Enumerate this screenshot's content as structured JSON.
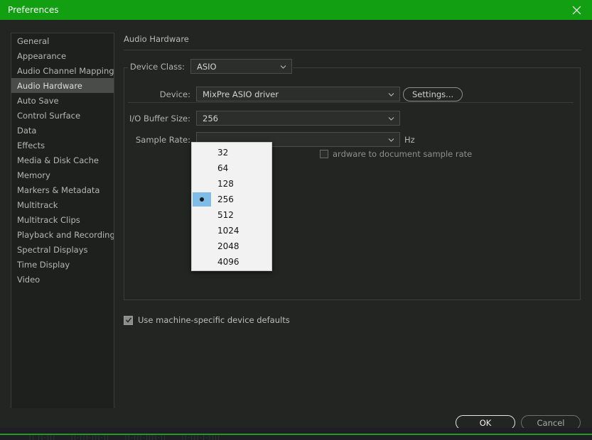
{
  "window": {
    "title": "Preferences",
    "close_icon": "close-x-icon",
    "titlebar_color": "#12a012"
  },
  "sidebar": {
    "items": [
      {
        "label": "General",
        "selected": false
      },
      {
        "label": "Appearance",
        "selected": false
      },
      {
        "label": "Audio Channel Mapping",
        "selected": false
      },
      {
        "label": "Audio Hardware",
        "selected": true
      },
      {
        "label": "Auto Save",
        "selected": false
      },
      {
        "label": "Control Surface",
        "selected": false
      },
      {
        "label": "Data",
        "selected": false
      },
      {
        "label": "Effects",
        "selected": false
      },
      {
        "label": "Media & Disk Cache",
        "selected": false
      },
      {
        "label": "Memory",
        "selected": false
      },
      {
        "label": "Markers & Metadata",
        "selected": false
      },
      {
        "label": "Multitrack",
        "selected": false
      },
      {
        "label": "Multitrack Clips",
        "selected": false
      },
      {
        "label": "Playback and Recording",
        "selected": false
      },
      {
        "label": "Spectral Displays",
        "selected": false
      },
      {
        "label": "Time Display",
        "selected": false
      },
      {
        "label": "Video",
        "selected": false
      }
    ]
  },
  "main": {
    "pane_title": "Audio Hardware",
    "device_class": {
      "label": "Device Class:",
      "value": "ASIO"
    },
    "device": {
      "label": "Device:",
      "value": "MixPre ASIO driver",
      "settings_button": "Settings..."
    },
    "buffer_size": {
      "label": "I/O Buffer Size:",
      "value": "256"
    },
    "sample_rate": {
      "label": "Sample Rate:",
      "value": "",
      "unit": "Hz"
    },
    "doc_sample_rate": {
      "label": "ardware to document sample rate",
      "checked": false
    },
    "machine_defaults": {
      "label": "Use machine-specific device defaults",
      "checked": true
    }
  },
  "dropdown": {
    "name": "io-buffer-size-dropdown",
    "selected": "256",
    "highlight_color": "#7fbde8",
    "options": [
      "32",
      "64",
      "128",
      "256",
      "512",
      "1024",
      "2048",
      "4096"
    ]
  },
  "footer": {
    "ok_label": "OK",
    "cancel_label": "Cancel"
  }
}
